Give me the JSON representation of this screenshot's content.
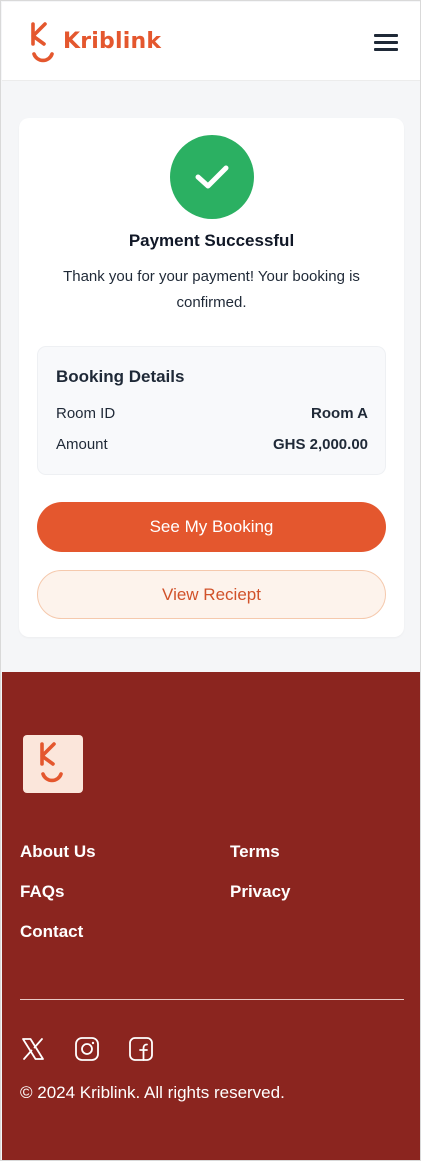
{
  "header": {
    "brand": "Kriblink",
    "menu_icon": "hamburger-menu-icon"
  },
  "payment": {
    "icon": "checkmark-icon",
    "title": "Payment Successful",
    "message": "Thank you for your payment! Your booking is confirmed."
  },
  "booking_details": {
    "title": "Booking Details",
    "rows": [
      {
        "label": "Room ID",
        "value": "Room A"
      },
      {
        "label": "Amount",
        "value": "GHS 2,000.00"
      }
    ]
  },
  "actions": {
    "primary_label": "See My Booking",
    "secondary_label": "View Reciept"
  },
  "footer": {
    "links_col1": [
      "About Us",
      "FAQs",
      "Contact"
    ],
    "links_col2": [
      "Terms",
      "Privacy"
    ],
    "social": [
      "x-icon",
      "instagram-icon",
      "facebook-icon"
    ],
    "copyright": "© 2024 Kriblink. All rights reserved."
  },
  "colors": {
    "brand": "#e4572e",
    "success": "#2bb062",
    "footer_bg": "#8b251f"
  }
}
